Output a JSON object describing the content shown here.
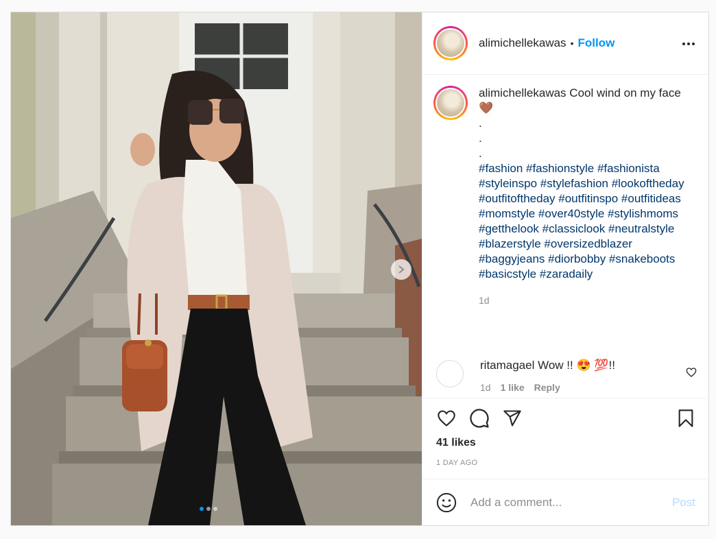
{
  "post": {
    "username": "alimichellekawas",
    "follow_label": "Follow",
    "separator": "•"
  },
  "caption": {
    "username": "alimichellekawas",
    "text": " Cool wind on my face🤎",
    "dots": [
      ".",
      ".",
      "."
    ],
    "hashtags": "#fashion #fashionstyle #fashionista #styleinspo #stylefashion #lookoftheday #outfitoftheday #outfitinspo #outfitideas #momstyle #over40style #stylishmoms #getthelook #classiclook #neutralstyle #blazerstyle #oversizedblazer #baggyjeans #diorbobby #snakeboots #basicstyle #zaradaily",
    "time": "1d"
  },
  "comment": {
    "username": "ritamagael",
    "text": " Wow !! 😍 💯!!",
    "time": "1d",
    "likes": "1 like",
    "reply_label": "Reply"
  },
  "engagement": {
    "likes": "41 likes",
    "posted": "1 DAY AGO"
  },
  "add_comment": {
    "placeholder": "Add a comment...",
    "post_label": "Post"
  },
  "carousel": {
    "total_images": 3,
    "current_index": 1
  },
  "colors": {
    "link_blue": "#0095f6",
    "hashtag": "#00376b",
    "muted": "#8e8e8e",
    "post_disabled": "#b3dbff"
  },
  "icons": [
    "more-icon",
    "heart-icon",
    "comment-icon",
    "share-icon",
    "bookmark-icon",
    "smile-icon",
    "chevron-right-icon"
  ]
}
